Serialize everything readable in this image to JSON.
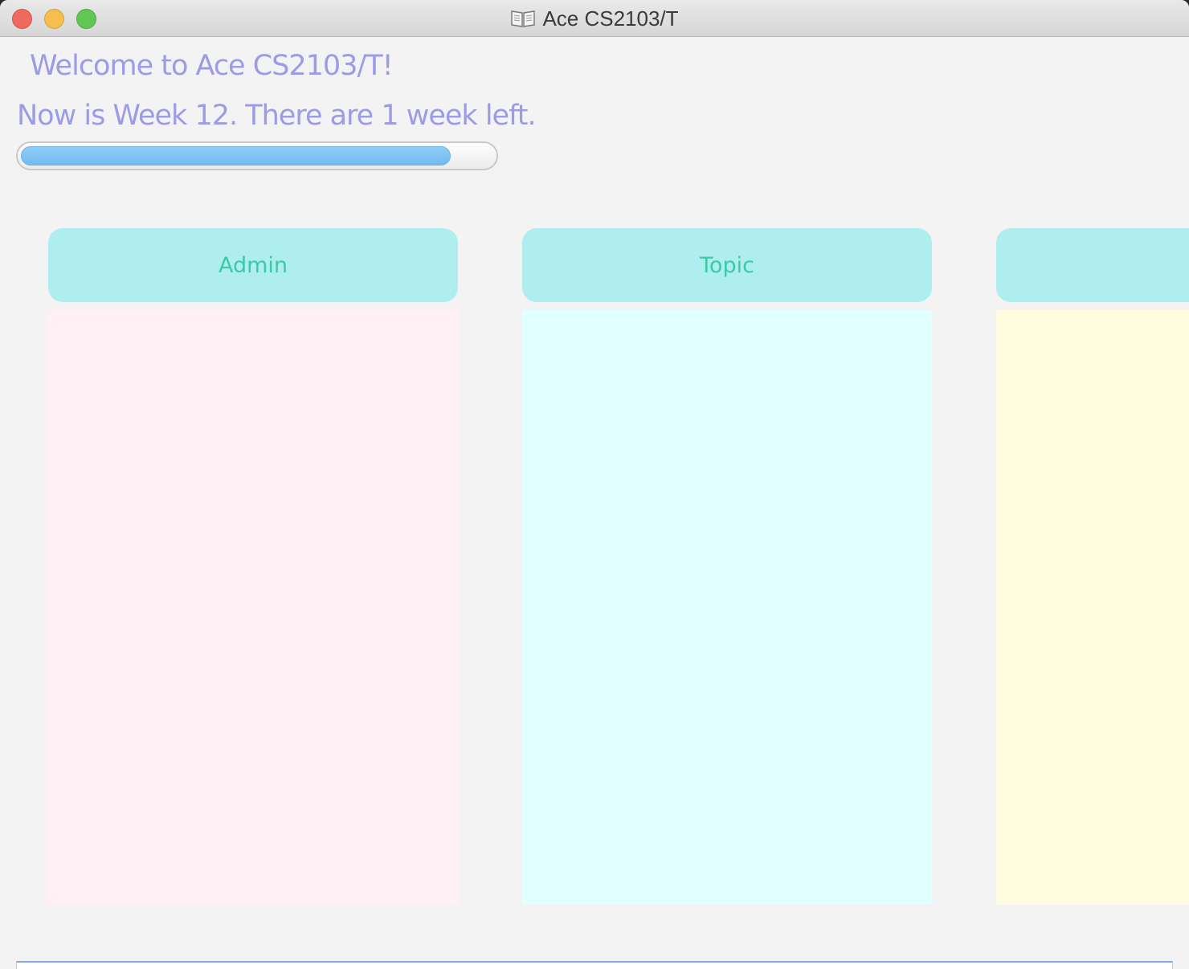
{
  "window": {
    "title": "Ace CS2103/T"
  },
  "icons": {
    "title_icon": "book-icon",
    "close": "close-icon",
    "minimize": "minimize-icon",
    "zoom": "zoom-icon"
  },
  "header": {
    "welcome": "Welcome to Ace CS2103/T!",
    "week_status": "Now is Week 12. There are 1 week left."
  },
  "progress": {
    "value": 0.91
  },
  "columns": [
    {
      "label": "Admin",
      "body_color": "#fff0f5"
    },
    {
      "label": "Topic",
      "body_color": "#e0ffff"
    },
    {
      "label": "",
      "body_color": "#fffde0"
    }
  ],
  "colors": {
    "accent_text": "#9b9be6",
    "header_bg": "#aeeeee",
    "header_text": "#3ccaa6",
    "progress_fill": "#7dc1f2"
  }
}
